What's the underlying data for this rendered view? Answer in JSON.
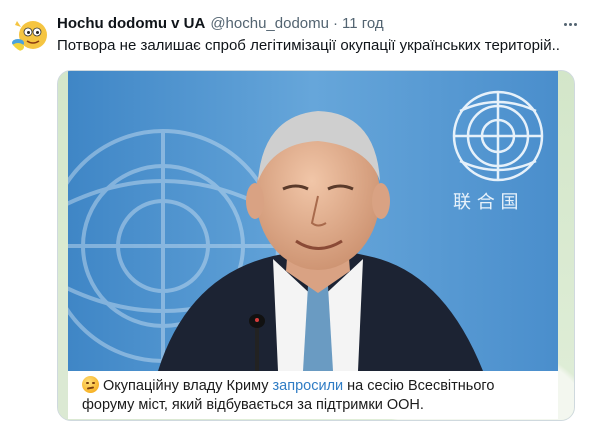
{
  "tweet": {
    "display_name": "Hochu dodomu v UA",
    "handle": "@hochu_dodomu",
    "separator": "·",
    "time": "11 год",
    "text": "Потвора не залишає спроб легітимізації окупації українських територій..",
    "more_icon": "more-horizontal-icon"
  },
  "media": {
    "photo_subject": "",
    "emblem_characters": "联 合 国",
    "caption_before": "Окупаційну владу Криму ",
    "caption_link": "запросили",
    "caption_after_line1": " на сесію Всесвітнього",
    "caption_line2": "форуму міст, який відбувається за підтримки ООН.",
    "caption_emoji": "slightly-smiling-face-emoji",
    "link_color": "#2f7cc4"
  },
  "colors": {
    "text_primary": "#0f1419",
    "text_secondary": "#536471",
    "un_blue": "#4b90cf",
    "card_green": "#d6e8cf"
  }
}
